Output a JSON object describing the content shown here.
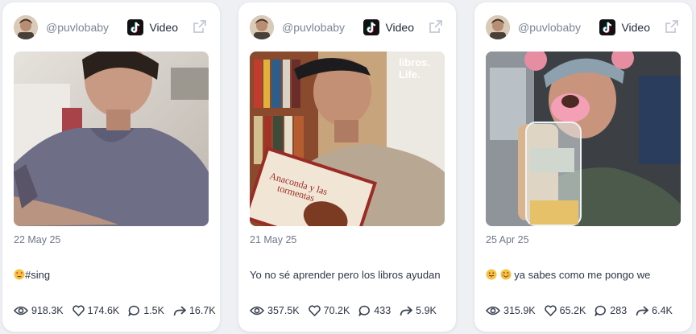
{
  "posts": [
    {
      "handle": "@puvlobaby",
      "platform_icon": "tiktok-icon",
      "type": "Video",
      "date": "22 May 25",
      "caption": "#sing",
      "caption_emoji": "heart-eyes-emoji",
      "stats": {
        "views": "918.3K",
        "likes": "174.6K",
        "comments": "1.5K",
        "shares": "16.7K"
      }
    },
    {
      "handle": "@puvlobaby",
      "platform_icon": "tiktok-icon",
      "type": "Video",
      "date": "21 May 25",
      "caption": "Yo no sé aprender pero los libros ayudan",
      "media_overlay": "libros.\nLife.",
      "book_title": "Anaconda y las tormentas",
      "stats": {
        "views": "357.5K",
        "likes": "70.2K",
        "comments": "433",
        "shares": "5.9K"
      }
    },
    {
      "handle": "@puvlobaby",
      "platform_icon": "tiktok-icon",
      "type": "Video",
      "date": "25 Apr 25",
      "caption": "ya sabes como me pongo we",
      "caption_emoji": "tongue-emoji, smile-emoji",
      "stats": {
        "views": "315.9K",
        "likes": "65.2K",
        "comments": "283",
        "shares": "6.4K"
      }
    }
  ],
  "icons": {
    "views": "eye-icon",
    "likes": "heart-icon",
    "comments": "comment-icon",
    "shares": "share-icon",
    "external": "external-link-icon"
  },
  "colors": {
    "card_bg": "#ffffff",
    "page_bg": "#eef0f4",
    "muted_text": "#7d8596",
    "main_text": "#2e3545"
  }
}
